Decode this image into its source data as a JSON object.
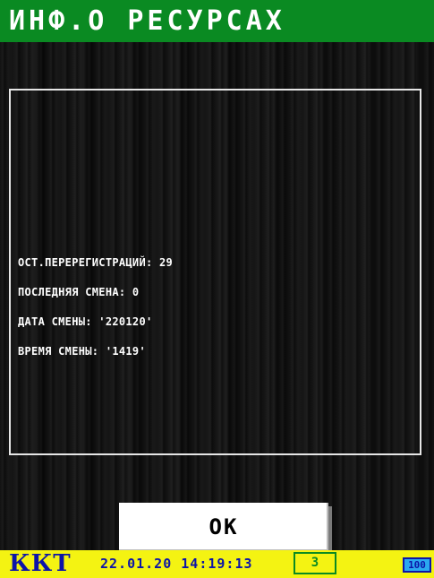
{
  "title": "ИНФ.О РЕСУРСАХ",
  "info": {
    "lines": [
      "ОСТ.ПЕРЕРЕГИСТРАЦИЙ: 29",
      "ПОСЛЕДНЯЯ СМЕНА: 0",
      "ДАТА СМЕНЫ: '220120'",
      "ВРЕМЯ СМЕНЫ: '1419'"
    ]
  },
  "ok_button": "OK",
  "status_bar": {
    "label": "ККТ",
    "datetime": "22.01.20 14:19:13",
    "counter": "3",
    "battery": "100"
  },
  "colors": {
    "title_bar": "#0a8a22",
    "status_bar": "#f4f312",
    "status_text": "#0c14a8",
    "battery_fill": "#2aa8f0"
  }
}
